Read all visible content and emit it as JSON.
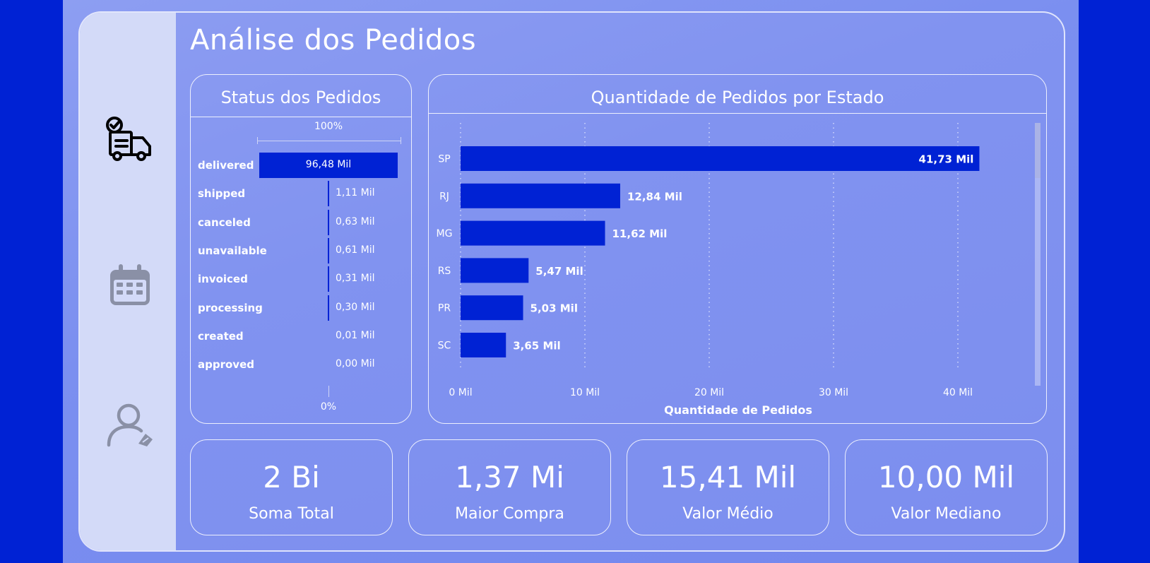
{
  "page": {
    "title": "Análise dos Pedidos"
  },
  "colors": {
    "accent": "#0022d4",
    "panel": "#d3daf8",
    "text": "#ffffff"
  },
  "sidebar": {
    "items": [
      {
        "icon": "delivery-truck-icon"
      },
      {
        "icon": "calendar-icon"
      },
      {
        "icon": "user-icon"
      }
    ]
  },
  "status_chart": {
    "title": "Status dos Pedidos",
    "top_label": "100%",
    "bottom_label": "0%",
    "rows": [
      {
        "label": "delivered",
        "value_text": "96,48 Mil",
        "value": 96.48
      },
      {
        "label": "shipped",
        "value_text": "1,11 Mil",
        "value": 1.11
      },
      {
        "label": "canceled",
        "value_text": "0,63 Mil",
        "value": 0.63
      },
      {
        "label": "unavailable",
        "value_text": "0,61 Mil",
        "value": 0.61
      },
      {
        "label": "invoiced",
        "value_text": "0,31 Mil",
        "value": 0.31
      },
      {
        "label": "processing",
        "value_text": "0,30 Mil",
        "value": 0.3
      },
      {
        "label": "created",
        "value_text": "0,01 Mil",
        "value": 0.01
      },
      {
        "label": "approved",
        "value_text": "0,00 Mil",
        "value": 0.0
      }
    ]
  },
  "chart_data": {
    "type": "bar",
    "orientation": "horizontal",
    "title": "Quantidade de Pedidos por Estado",
    "xlabel": "Quantidade de Pedidos",
    "ylabel": "",
    "categories": [
      "SP",
      "RJ",
      "MG",
      "RS",
      "PR",
      "SC"
    ],
    "values": [
      41.73,
      12.84,
      11.62,
      5.47,
      5.03,
      3.65
    ],
    "value_labels": [
      "41,73 Mil",
      "12,84 Mil",
      "11,62 Mil",
      "5,47 Mil",
      "5,03 Mil",
      "3,65 Mil"
    ],
    "xlim": [
      0,
      44
    ],
    "xticks": [
      0,
      10,
      20,
      30,
      40
    ],
    "xtick_labels": [
      "0 Mil",
      "10 Mil",
      "20 Mil",
      "30 Mil",
      "40 Mil"
    ],
    "grid": "vertical dotted",
    "bar_color": "#0022d4"
  },
  "kpis": [
    {
      "value": "2 Bi",
      "label": "Soma Total"
    },
    {
      "value": "1,37 Mi",
      "label": "Maior Compra"
    },
    {
      "value": "15,41 Mil",
      "label": "Valor Médio"
    },
    {
      "value": "10,00 Mil",
      "label": "Valor Mediano"
    }
  ]
}
